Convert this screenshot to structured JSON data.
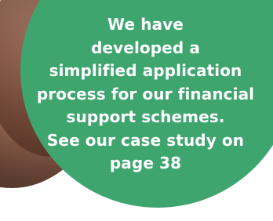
{
  "callout": {
    "lines": [
      "We have",
      "developed a",
      "simplified application",
      "process for our financial",
      "support schemes.",
      "See our case study on",
      "page 38"
    ],
    "background_color": "#3fa56f",
    "text_color": "#ffffff"
  },
  "photo": {
    "icon": "person-photo"
  }
}
